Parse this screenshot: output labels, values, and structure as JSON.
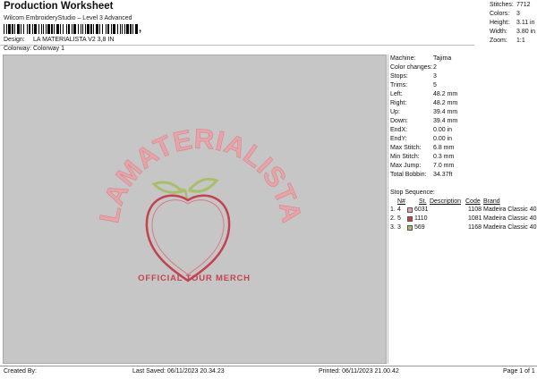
{
  "header": {
    "title": "Production Worksheet",
    "subtitle": "Wilcom EmbroideryStudio – Level 3 Advanced",
    "barcode_suffix": ","
  },
  "design_info": {
    "design_label": "Design:",
    "design_value": "LA MATERIALISTA V2 3,8 IN",
    "colorway_label": "Colorway:",
    "colorway_value": "Colorway 1"
  },
  "summary": {
    "stitches_label": "Stitches:",
    "stitches": "7712",
    "colors_label": "Colors:",
    "colors": "3",
    "height_label": "Height:",
    "height": "3.11 in",
    "width_label": "Width:",
    "width": "3.80 in",
    "zoom_label": "Zoom:",
    "zoom": "1:1"
  },
  "preview": {
    "arc_text": "LAMATERIALISTA",
    "caption": "OFFICIAL TOUR MERCH",
    "arc_color": "#e6a3a8",
    "peach_color": "#c2434f",
    "leaf_color": "#a9be6a",
    "caption_color": "#c2434f"
  },
  "machine_details": [
    {
      "label": "Machine:",
      "value": "Tajima"
    },
    {
      "label": "Color changes:",
      "value": "2"
    },
    {
      "label": "Stops:",
      "value": "3"
    },
    {
      "label": "Trims:",
      "value": "5"
    },
    {
      "label": "Left:",
      "value": "48.2 mm"
    },
    {
      "label": "Right:",
      "value": "48.2 mm"
    },
    {
      "label": "Up:",
      "value": "39.4 mm"
    },
    {
      "label": "Down:",
      "value": "39.4 mm"
    },
    {
      "label": "EndX:",
      "value": "0.00 in"
    },
    {
      "label": "EndY:",
      "value": "0.00 in"
    },
    {
      "label": "Max Stitch:",
      "value": "6.8 mm"
    },
    {
      "label": "Min Stitch:",
      "value": "0.3 mm"
    },
    {
      "label": "Max Jump:",
      "value": "7.0 mm"
    },
    {
      "label": "Total Bobbin:",
      "value": "34.37ft"
    }
  ],
  "stop_sequence": {
    "title": "Stop Sequence:",
    "headers": {
      "n": "N#",
      "st": "St.",
      "description": "Description",
      "code": "Code",
      "brand": "Brand"
    },
    "rows": [
      {
        "idx": "1.",
        "n": "4",
        "color": "#e6a3a8",
        "st": "6031",
        "code": "1108",
        "brand": "Madeira Classic 40"
      },
      {
        "idx": "2.",
        "n": "5",
        "color": "#c2434f",
        "st": "1110",
        "code": "1081",
        "brand": "Madeira Classic 40"
      },
      {
        "idx": "3.",
        "n": "3",
        "color": "#a9be6a",
        "st": "569",
        "code": "1168",
        "brand": "Madeira Classic 40"
      }
    ]
  },
  "footer": {
    "created_by": "Created By:",
    "last_saved": "Last Saved: 06/11/2023 20.34.23",
    "printed": "Printed: 06/11/2023 21.00.42",
    "page": "Page 1 of 1"
  }
}
